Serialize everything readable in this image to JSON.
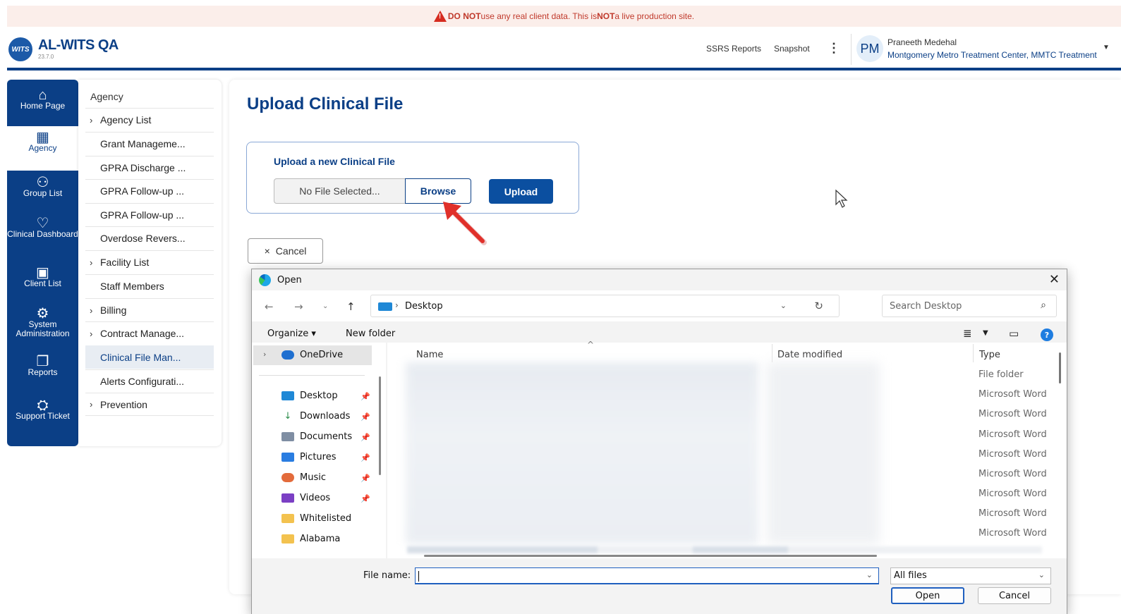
{
  "banner": {
    "part1": "DO NOT",
    "part2": " use any real client data. This is ",
    "part3": "NOT",
    "part4": " a live production site."
  },
  "header": {
    "logo_text": "WITS",
    "app_title": "AL-WITS QA",
    "version": "23.7.0",
    "links": [
      "SSRS Reports",
      "Snapshot"
    ],
    "kebab": "⋮",
    "user_initials": "PM",
    "user_name": "Praneeth Medehal",
    "user_org": "Montgomery Metro Treatment Center, MMTC Treatment"
  },
  "leftnav": [
    {
      "label": "Home Page",
      "icon": "home-icon"
    },
    {
      "label": "Agency",
      "icon": "building-icon"
    },
    {
      "label": "Group List",
      "icon": "group-icon"
    },
    {
      "label": "Clinical Dashboard",
      "icon": "clinical-icon"
    },
    {
      "label": "Client List",
      "icon": "clipboard-icon"
    },
    {
      "label": "System Administration",
      "icon": "gear-icon"
    },
    {
      "label": "Reports",
      "icon": "copy-icon"
    },
    {
      "label": "Support Ticket",
      "icon": "ticket-icon"
    }
  ],
  "submenu": {
    "heading": "Agency",
    "items": [
      {
        "label": "Agency List",
        "chevron": true
      },
      {
        "label": "Grant Manageme...",
        "chevron": false
      },
      {
        "label": "GPRA Discharge ...",
        "chevron": false
      },
      {
        "label": "GPRA Follow-up ...",
        "chevron": false
      },
      {
        "label": "GPRA Follow-up ...",
        "chevron": false
      },
      {
        "label": "Overdose Revers...",
        "chevron": false
      },
      {
        "label": "Facility List",
        "chevron": true
      },
      {
        "label": "Staff Members",
        "chevron": false
      },
      {
        "label": "Billing",
        "chevron": true
      },
      {
        "label": "Contract Manage...",
        "chevron": true
      },
      {
        "label": "Clinical File Man...",
        "chevron": false,
        "active": true
      },
      {
        "label": "Alerts Configurati...",
        "chevron": false
      },
      {
        "label": "Prevention",
        "chevron": true
      }
    ]
  },
  "main": {
    "title": "Upload Clinical File",
    "upload_label": "Upload a new Clinical File",
    "file_placeholder": "No File Selected...",
    "browse_label": "Browse",
    "upload_btn": "Upload",
    "cancel_btn": "Cancel"
  },
  "dialog": {
    "title": "Open",
    "address": "Desktop",
    "search_placeholder": "Search Desktop",
    "organize": "Organize",
    "new_folder": "New folder",
    "nav_items": [
      {
        "label": "OneDrive",
        "color": "#1f6fd0"
      },
      {
        "label": "Desktop",
        "color": "#1f88d6",
        "pinned": true
      },
      {
        "label": "Downloads",
        "color": "#2a8c4a",
        "pinned": true
      },
      {
        "label": "Documents",
        "color": "#7f8ea3",
        "pinned": true
      },
      {
        "label": "Pictures",
        "color": "#2a7de1",
        "pinned": true
      },
      {
        "label": "Music",
        "color": "#e36b3b",
        "pinned": true
      },
      {
        "label": "Videos",
        "color": "#7b3fc4",
        "pinned": true
      },
      {
        "label": "Whitelisted",
        "color": "#f3c24f"
      },
      {
        "label": "Alabama",
        "color": "#f3c24f"
      }
    ],
    "columns": [
      "Name",
      "Date modified",
      "Type"
    ],
    "types": [
      "File folder",
      "Microsoft Word",
      "Microsoft Word",
      "Microsoft Word",
      "Microsoft Word",
      "Microsoft Word",
      "Microsoft Word",
      "Microsoft Word",
      "Microsoft Word"
    ],
    "file_name_label": "File name:",
    "filter": "All files",
    "open_btn": "Open",
    "cancel_btn": "Cancel"
  },
  "colors": {
    "brand": "#0b3f86",
    "warning": "#d62b1f",
    "arrow": "#e0302a"
  }
}
